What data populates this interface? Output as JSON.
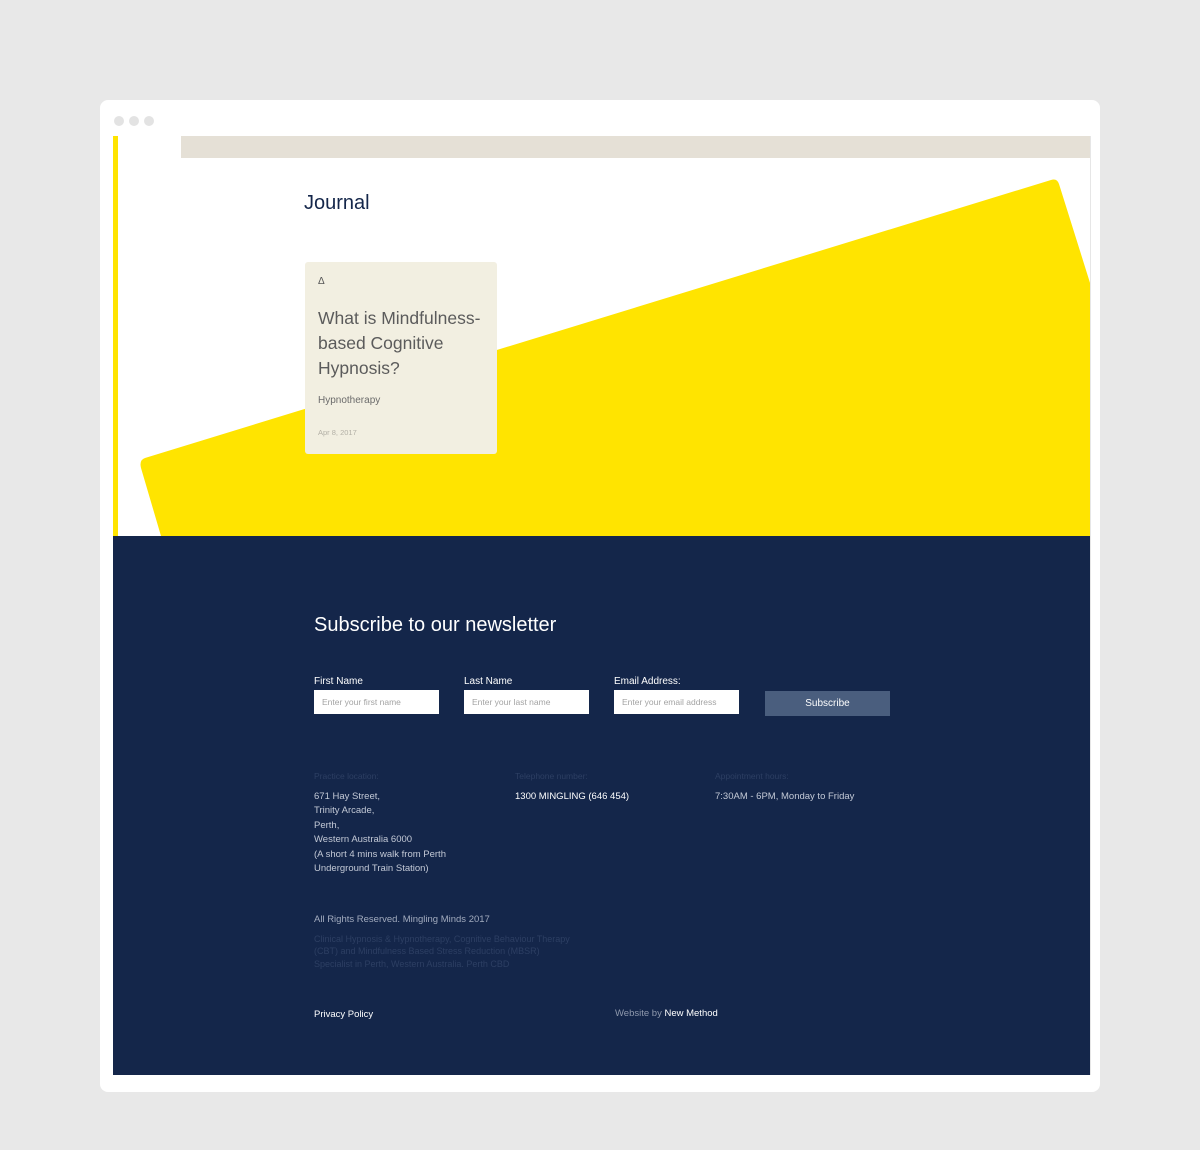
{
  "browser": {
    "controls": [
      "close",
      "minimize",
      "maximize"
    ]
  },
  "journal": {
    "title": "Journal",
    "post": {
      "icon": "delta-icon",
      "icon_glyph": "Δ",
      "title": "What is Mindfulness-based Cognitive Hypnosis?",
      "category": "Hypnotherapy",
      "date": "Apr 8, 2017"
    }
  },
  "newsletter": {
    "title": "Subscribe to our newsletter",
    "first_name": {
      "label": "First Name",
      "placeholder": "Enter your first name",
      "value": ""
    },
    "last_name": {
      "label": "Last Name",
      "placeholder": "Enter your last name",
      "value": ""
    },
    "email": {
      "label": "Email Address:",
      "placeholder": "Enter your email address",
      "value": ""
    },
    "subscribe_label": "Subscribe"
  },
  "contact": {
    "location": {
      "label": "Practice location:",
      "lines": [
        "671 Hay Street,",
        "Trinity Arcade,",
        "Perth,",
        "Western Australia 6000",
        "(A short 4 mins walk from Perth",
        "Underground Train Station)"
      ]
    },
    "phone": {
      "label": "Telephone number:",
      "value": "1300 MINGLING (646 454)"
    },
    "hours": {
      "label": "Appointment hours:",
      "value": "7:30AM - 6PM, Monday to Friday"
    }
  },
  "legal": {
    "rights": "All Rights Reserved. Mingling Minds 2017",
    "seo": [
      "Clinical Hypnosis & Hypnotherapy, Cognitive Behaviour Therapy",
      "(CBT) and Mindfulness Based Stress Reduction (MBSR)",
      "Specialist in Perth, Western Australia. Perth CBD"
    ],
    "privacy": "Privacy Policy",
    "credit_prefix": "Website by ",
    "credit_link": "New Method"
  },
  "colors": {
    "navy": "#14264a",
    "yellow": "#ffe400",
    "card": "#f2efe1",
    "button": "#4a5e7e",
    "strip": "#e5e0d6",
    "backdrop": "#e8e8e8"
  }
}
